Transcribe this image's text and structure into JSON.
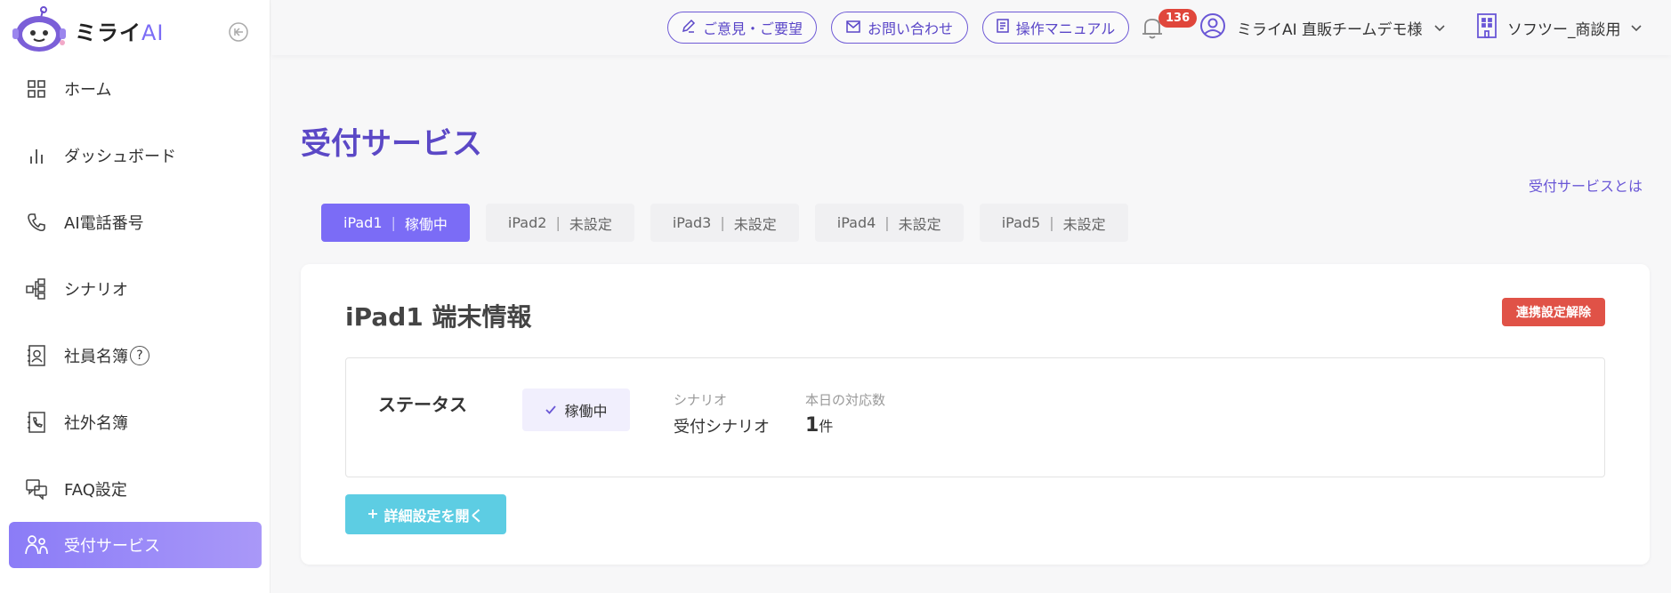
{
  "app": {
    "logo_text": "ミライ",
    "logo_ai": "AI"
  },
  "sidebar": {
    "items": [
      {
        "label": "ホーム",
        "icon": "grid-icon"
      },
      {
        "label": "ダッシュボード",
        "icon": "bar-chart-icon"
      },
      {
        "label": "AI電話番号",
        "icon": "phone-icon"
      },
      {
        "label": "シナリオ",
        "icon": "flow-icon"
      },
      {
        "label": "社員名簿",
        "icon": "contact-book-icon",
        "help": "?"
      },
      {
        "label": "社外名簿",
        "icon": "phone-book-icon"
      },
      {
        "label": "FAQ設定",
        "icon": "faq-chat-icon"
      },
      {
        "label": "受付サービス",
        "icon": "people-icon",
        "active": true
      }
    ]
  },
  "header": {
    "feedback_label": "ご意見・ご要望",
    "contact_label": "お問い合わせ",
    "manual_label": "操作マニュアル",
    "notification_count": "136",
    "user_name": "ミライAI 直販チームデモ様",
    "company_name": "ソフツー_商談用"
  },
  "main": {
    "title": "受付サービス",
    "about_link": "受付サービスとは",
    "tabs": [
      {
        "device": "iPad1",
        "status": "稼働中",
        "active": true
      },
      {
        "device": "iPad2",
        "status": "未設定"
      },
      {
        "device": "iPad3",
        "status": "未設定"
      },
      {
        "device": "iPad4",
        "status": "未設定"
      },
      {
        "device": "iPad5",
        "status": "未設定"
      }
    ],
    "card": {
      "title": "iPad1 端末情報",
      "unlink_label": "連携設定解除",
      "status_label": "ステータス",
      "status_value": "稼働中",
      "scenario_key": "シナリオ",
      "scenario_value": "受付シナリオ",
      "today_key": "本日の対応数",
      "today_count": "1",
      "today_unit": "件",
      "detail_button": "詳細設定を開く"
    }
  },
  "colors": {
    "accent": "#7b6cf6",
    "title": "#5b48c6",
    "danger": "#e05247",
    "info": "#5dcde3",
    "badge": "#e0463b"
  }
}
